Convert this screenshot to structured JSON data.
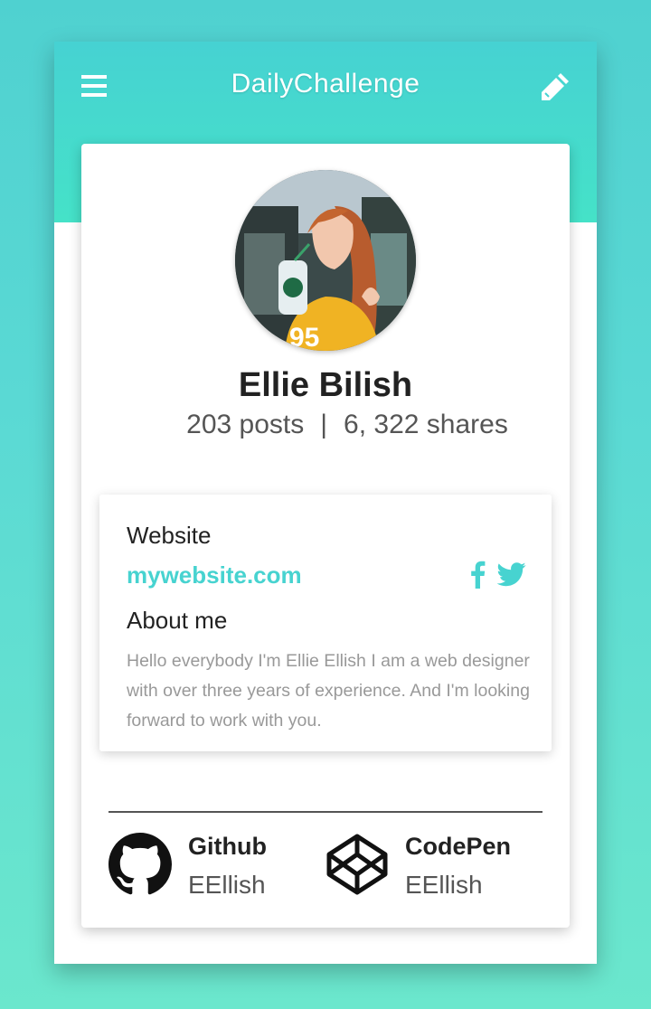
{
  "header": {
    "title": "DailyChallenge",
    "menu_icon": "hamburger-menu-icon",
    "edit_icon": "pencil-icon"
  },
  "profile": {
    "name": "Ellie Bilish",
    "posts": "203 posts",
    "separator": "|",
    "shares": "6, 322 shares"
  },
  "info": {
    "website_label": "Website",
    "website_url": "mywebsite.com",
    "about_label": "About me",
    "about_text": "Hello everybody I'm Ellie Ellish I am a web designer with over three years of experience. And I'm looking forward to work with you."
  },
  "links": [
    {
      "title": "Github",
      "user": "EEllish",
      "icon": "github-icon"
    },
    {
      "title": "CodePen",
      "user": "EEllish",
      "icon": "codepen-icon"
    }
  ],
  "colors": {
    "accent": "#47d3d0",
    "header_start": "#46d2d2",
    "header_end": "#45e2c8"
  }
}
